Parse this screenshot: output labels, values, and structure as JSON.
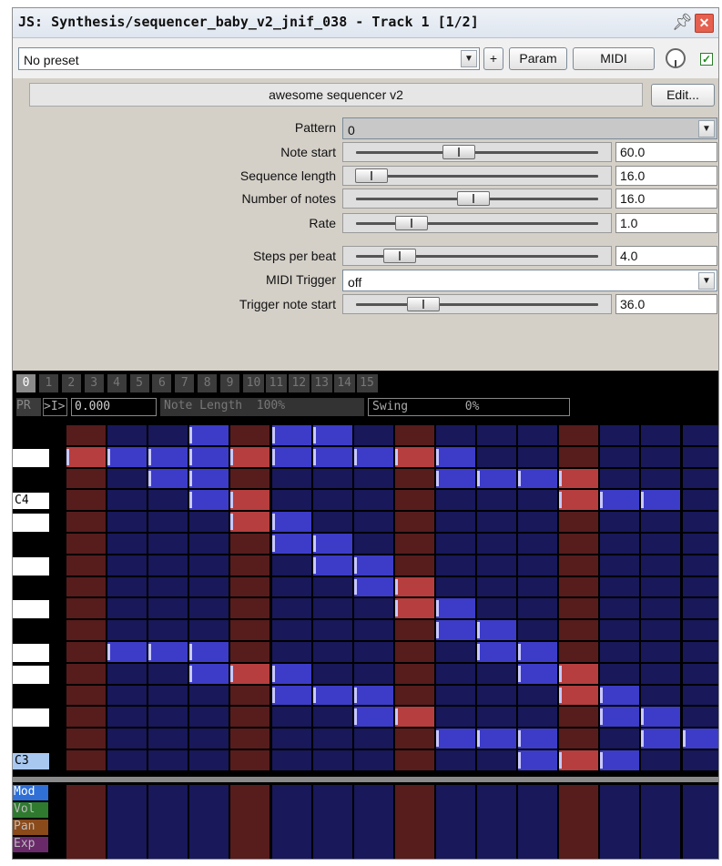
{
  "window": {
    "title": "JS: Synthesis/sequencer_baby_v2_jnif_038 - Track 1 [1/2]"
  },
  "toolbar": {
    "preset": "No preset",
    "add_label": "+",
    "param_label": "Param",
    "midi_label": "MIDI",
    "enabled": true
  },
  "effect": {
    "name": "awesome sequencer v2",
    "edit_label": "Edit..."
  },
  "params": [
    {
      "label": "Pattern",
      "type": "dropdown",
      "value": "0"
    },
    {
      "label": "Note start",
      "type": "slider",
      "value": "60.0",
      "fraction": 0.42
    },
    {
      "label": "Sequence length",
      "type": "slider",
      "value": "16.0",
      "fraction": 0.05
    },
    {
      "label": "Number of notes",
      "type": "slider",
      "value": "16.0",
      "fraction": 0.48
    },
    {
      "label": "Rate",
      "type": "slider",
      "value": "1.0",
      "fraction": 0.22
    },
    {
      "label": "Steps per beat",
      "type": "slider",
      "value": "4.0",
      "fraction": 0.17
    },
    {
      "label": "MIDI Trigger",
      "type": "dropdown",
      "value": "off"
    },
    {
      "label": "Trigger note start",
      "type": "slider",
      "value": "36.0",
      "fraction": 0.27
    }
  ],
  "sequencer": {
    "pattern_tabs": [
      "0",
      "1",
      "2",
      "3",
      "4",
      "5",
      "6",
      "7",
      "8",
      "9",
      "10",
      "11",
      "12",
      "13",
      "14",
      "15"
    ],
    "active_pattern": 0,
    "pr_label": "PR",
    "play_label": ">I>",
    "position": "0.000",
    "note_length": "Note Length  100%",
    "swing": "Swing        0%",
    "key_labels": {
      "c4": "C4",
      "c3": "C3"
    },
    "lanes": [
      "Mod",
      "Vol",
      "Pan",
      "Exp"
    ],
    "lane_colors": [
      "#2f6fd6",
      "#2f7a2f",
      "#8a4a1a",
      "#6a2a6a"
    ],
    "colors": {
      "dark_cell": "#18185a",
      "beat_cell": "#571c1c",
      "note_blue": "#3c3cc8",
      "note_red": "#b63e3e"
    },
    "steps": 16,
    "beat_columns": [
      0,
      4,
      8,
      12
    ],
    "rows": 16,
    "notes": [
      {
        "row": 0,
        "cols": [
          3,
          5,
          6
        ]
      },
      {
        "row": 1,
        "cols": [
          0,
          1,
          2,
          3,
          4,
          5,
          6,
          7,
          8,
          9
        ]
      },
      {
        "row": 2,
        "cols": [
          2,
          3,
          9,
          10,
          11,
          12
        ]
      },
      {
        "row": 3,
        "cols": [
          3,
          4,
          12,
          13,
          14
        ]
      },
      {
        "row": 4,
        "cols": [
          4,
          5
        ]
      },
      {
        "row": 5,
        "cols": [
          5,
          6
        ]
      },
      {
        "row": 6,
        "cols": [
          6,
          7
        ]
      },
      {
        "row": 7,
        "cols": [
          7,
          8
        ]
      },
      {
        "row": 8,
        "cols": [
          8,
          9
        ]
      },
      {
        "row": 9,
        "cols": [
          9,
          10
        ]
      },
      {
        "row": 10,
        "cols": [
          1,
          2,
          3,
          10,
          11
        ]
      },
      {
        "row": 11,
        "cols": [
          3,
          4,
          5,
          11,
          12
        ]
      },
      {
        "row": 12,
        "cols": [
          5,
          6,
          7,
          12,
          13
        ]
      },
      {
        "row": 13,
        "cols": [
          7,
          8,
          13,
          14
        ]
      },
      {
        "row": 14,
        "cols": [
          9,
          10,
          11,
          14,
          15
        ]
      },
      {
        "row": 15,
        "cols": [
          11,
          12,
          13
        ]
      }
    ]
  }
}
